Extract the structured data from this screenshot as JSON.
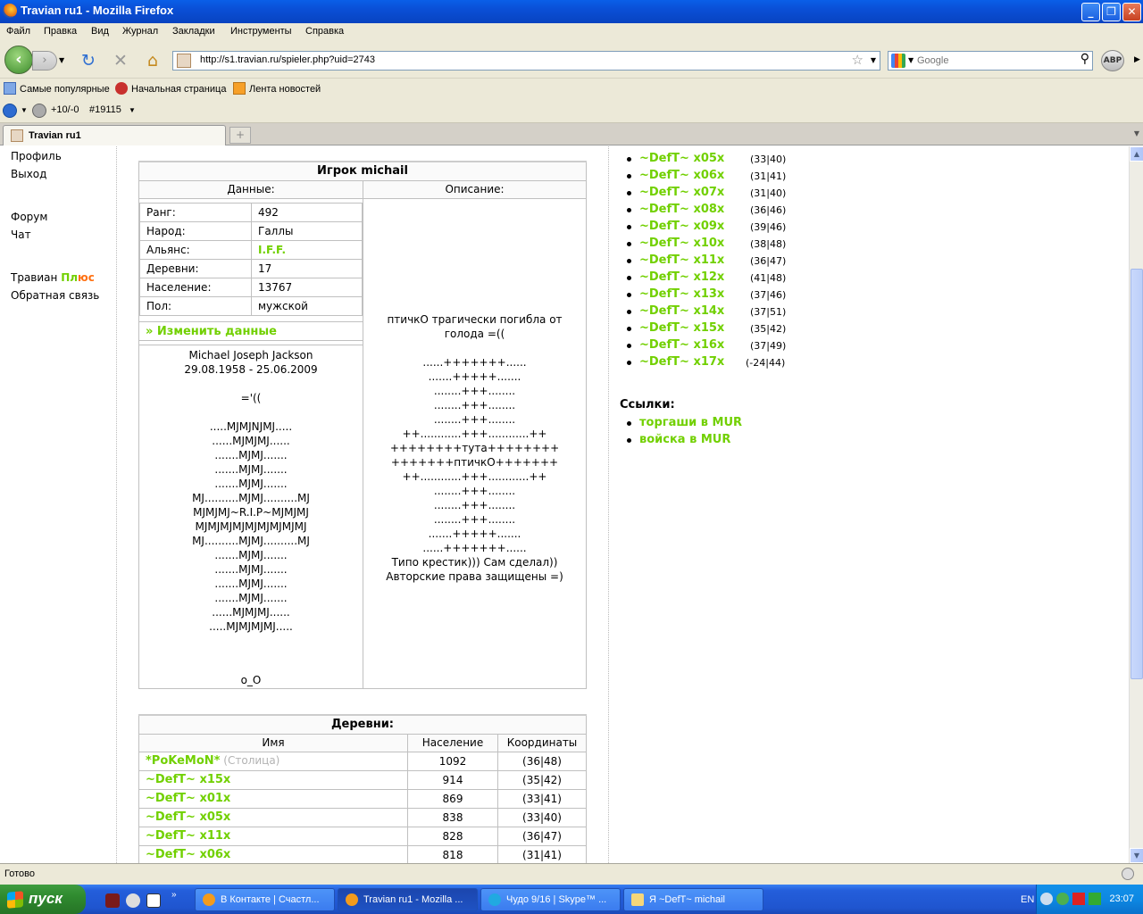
{
  "window": {
    "title": "Travian ru1 - Mozilla Firefox",
    "min": "_",
    "max": "❐",
    "close": "✕"
  },
  "menu": [
    "Файл",
    "Правка",
    "Вид",
    "Журнал",
    "Закладки",
    "Инструменты",
    "Справка"
  ],
  "nav": {
    "url": "http://s1.travian.ru/spieler.php?uid=2743",
    "search_placeholder": "Google",
    "abp": "ABP"
  },
  "bookmarks": [
    "Самые популярные",
    "Начальная страница",
    "Лента новостей"
  ],
  "addon": {
    "score": "+10/-0",
    "rank": "#19115"
  },
  "tab": {
    "label": "Travian ru1",
    "new": "+"
  },
  "sidebar": {
    "profile": "Профиль",
    "logout": "Выход",
    "forum": "Форум",
    "chat": "Чат",
    "travian": "Травиан",
    "plus_p": "Пл",
    "plus_rest": "юс",
    "feedback": "Обратная связь"
  },
  "profile": {
    "title": "Игрок michail",
    "col_data": "Данные:",
    "col_desc": "Описание:",
    "fields": [
      {
        "label": "Ранг:",
        "value": "492"
      },
      {
        "label": "Народ:",
        "value": "Галлы"
      },
      {
        "label": "Альянс:",
        "value": "I.F.F."
      },
      {
        "label": "Деревни:",
        "value": "17"
      },
      {
        "label": "Население:",
        "value": "13767"
      },
      {
        "label": "Пол:",
        "value": "мужской"
      }
    ],
    "edit_link": "» Изменить данные",
    "bio_left": "Michael Joseph Jackson\n29.08.1958 - 25.06.2009\n\n='((\n\n.....MJMJNJMJ.....\n......MJMJMJ......\n.......MJMJ.......\n.......MJMJ.......\n.......MJMJ.......\nMJ..........MJMJ..........MJ\nMJMJMJ~R.I.P~MJMJMJ\nMJMJMJMJMJMJMJMJMJ\nMJ..........MJMJ..........MJ\n.......MJMJ.......\n.......MJMJ.......\n.......MJMJ.......\n.......MJMJ.......\n......MJMJMJ......\n.....MJMJMJMJ.....",
    "bio_left_footer": "o_O",
    "bio_right": "птичкО трагически погибла от\nголода =((\n\n......+++++++......\n.......+++++.......\n........+++........\n........+++........\n........+++........\n++............+++............++\n++++++++тута++++++++\n+++++++птичкО+++++++\n++............+++............++\n........+++........\n........+++........\n........+++........\n.......+++++.......\n......+++++++......\nТипо крестик))) Сам сделал))\nАвторские права защищены =)"
  },
  "villages": {
    "title": "Деревни:",
    "headers": [
      "Имя",
      "Население",
      "Координаты"
    ],
    "rows": [
      {
        "name": "*PoKeMoN*",
        "tag": "(Столица)",
        "pop": "1092",
        "coords": "(36|48)"
      },
      {
        "name": "~DefT~ x15x",
        "tag": "",
        "pop": "914",
        "coords": "(35|42)"
      },
      {
        "name": "~DefT~ x01x",
        "tag": "",
        "pop": "869",
        "coords": "(33|41)"
      },
      {
        "name": "~DefT~ x05x",
        "tag": "",
        "pop": "838",
        "coords": "(33|40)"
      },
      {
        "name": "~DefT~ x11x",
        "tag": "",
        "pop": "828",
        "coords": "(36|47)"
      },
      {
        "name": "~DefT~ x06x",
        "tag": "",
        "pop": "818",
        "coords": "(31|41)"
      }
    ]
  },
  "right_villages": [
    {
      "name": "~DefT~ x05x",
      "coords": "(33|40)"
    },
    {
      "name": "~DefT~ x06x",
      "coords": "(31|41)"
    },
    {
      "name": "~DefT~ x07x",
      "coords": "(31|40)"
    },
    {
      "name": "~DefT~ x08x",
      "coords": "(36|46)"
    },
    {
      "name": "~DefT~ x09x",
      "coords": "(39|46)"
    },
    {
      "name": "~DefT~ x10x",
      "coords": "(38|48)"
    },
    {
      "name": "~DefT~ x11x",
      "coords": "(36|47)"
    },
    {
      "name": "~DefT~ x12x",
      "coords": "(41|48)"
    },
    {
      "name": "~DefT~ x13x",
      "coords": "(37|46)"
    },
    {
      "name": "~DefT~ x14x",
      "coords": "(37|51)"
    },
    {
      "name": "~DefT~ x15x",
      "coords": "(35|42)"
    },
    {
      "name": "~DefT~ x16x",
      "coords": "(37|49)"
    },
    {
      "name": "~DefT~ x17x",
      "coords": "(-24|44)"
    }
  ],
  "links": {
    "title": "Ссылки:",
    "items": [
      "торгаши в MUR",
      "войска в MUR"
    ]
  },
  "status": "Готово",
  "taskbar": {
    "start": "пуск",
    "tasks": [
      "В Контакте | Счастл...",
      "Travian ru1 - Mozilla ...",
      "Чудо 9/16 | Skype™ ...",
      "Я ~DefT~ michail"
    ],
    "lang": "EN",
    "time": "23:07"
  }
}
